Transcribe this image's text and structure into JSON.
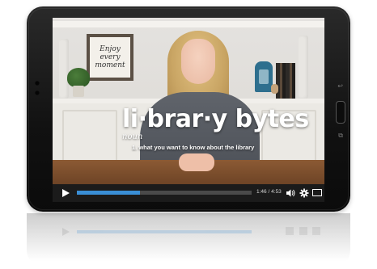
{
  "video": {
    "overlay": {
      "title": "li·brar·y bytes",
      "part_of_speech": "noun",
      "definition": "1. what you want to know about the library"
    },
    "frame_sign": {
      "line1": "Enjoy",
      "line2": "every",
      "line3": "moment"
    }
  },
  "player": {
    "time_display": "1:46 / 4:53",
    "progress_fraction": 0.362,
    "progress_color": "#3a8fd6",
    "icons": {
      "play": "play-icon",
      "volume": "volume-icon",
      "settings": "gear-icon",
      "fullscreen": "fullscreen-icon"
    }
  },
  "device": {
    "hardware_icons": [
      "back-icon",
      "home-button",
      "recent-apps-icon"
    ]
  }
}
